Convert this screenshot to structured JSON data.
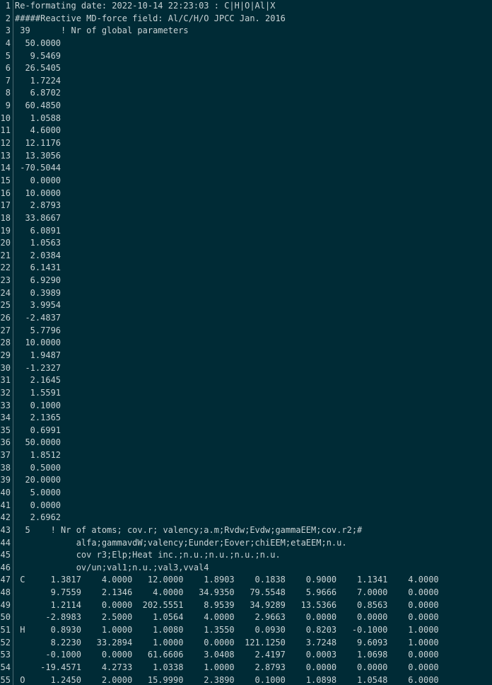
{
  "line_numbers": [
    "1",
    "2",
    "3",
    "4",
    "5",
    "6",
    "7",
    "8",
    "9",
    "10",
    "11",
    "12",
    "13",
    "14",
    "15",
    "16",
    "17",
    "18",
    "19",
    "20",
    "21",
    "22",
    "23",
    "24",
    "25",
    "26",
    "27",
    "28",
    "29",
    "30",
    "31",
    "32",
    "33",
    "34",
    "35",
    "36",
    "37",
    "38",
    "39",
    "40",
    "41",
    "42",
    "43",
    "44",
    "45",
    "46",
    "47",
    "48",
    "49",
    "50",
    "51",
    "52",
    "53",
    "54",
    "55"
  ],
  "lines": [
    "Re-formating date: 2022-10-14 22:23:03 : C|H|O|Al|X",
    "#####Reactive MD-force field: Al/C/H/O JPCC Jan. 2016",
    " 39      ! Nr of global parameters",
    "  50.0000",
    "   9.5469",
    "  26.5405",
    "   1.7224",
    "   6.8702",
    "  60.4850",
    "   1.0588",
    "   4.6000",
    "  12.1176",
    "  13.3056",
    " -70.5044",
    "   0.0000",
    "  10.0000",
    "   2.8793",
    "  33.8667",
    "   6.0891",
    "   1.0563",
    "   2.0384",
    "   6.1431",
    "   6.9290",
    "   0.3989",
    "   3.9954",
    "  -2.4837",
    "   5.7796",
    "  10.0000",
    "   1.9487",
    "  -1.2327",
    "   2.1645",
    "   1.5591",
    "   0.1000",
    "   2.1365",
    "   0.6991",
    "  50.0000",
    "   1.8512",
    "   0.5000",
    "  20.0000",
    "   5.0000",
    "   0.0000",
    "   2.6962",
    "  5    ! Nr of atoms; cov.r; valency;a.m;Rvdw;Evdw;gammaEEM;cov.r2;#",
    "            alfa;gammavdW;valency;Eunder;Eover;chiEEM;etaEEM;n.u.",
    "            cov r3;Elp;Heat inc.;n.u.;n.u.;n.u.;n.u.",
    "            ov/un;val1;n.u.;val3,vval4",
    " C     1.3817    4.0000   12.0000    1.8903    0.1838    0.9000    1.1341    4.0000",
    "       9.7559    2.1346    4.0000   34.9350   79.5548    5.9666    7.0000    0.0000",
    "       1.2114    0.0000  202.5551    8.9539   34.9289   13.5366    0.8563    0.0000",
    "      -2.8983    2.5000    1.0564    4.0000    2.9663    0.0000    0.0000    0.0000",
    " H     0.8930    1.0000    1.0080    1.3550    0.0930    0.8203   -0.1000    1.0000",
    "       8.2230   33.2894    1.0000    0.0000  121.1250    3.7248    9.6093    1.0000",
    "      -0.1000    0.0000   61.6606    3.0408    2.4197    0.0003    1.0698    0.0000",
    "     -19.4571    4.2733    1.0338    1.0000    2.8793    0.0000    0.0000    0.0000",
    " O     1.2450    2.0000   15.9990    2.3890    0.1000    1.0898    1.0548    6.0000"
  ]
}
